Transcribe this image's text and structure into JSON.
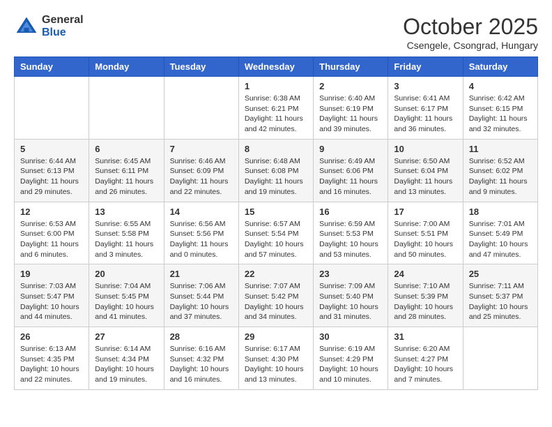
{
  "header": {
    "logo_general": "General",
    "logo_blue": "Blue",
    "month_title": "October 2025",
    "location": "Csengele, Csongrad, Hungary"
  },
  "days_of_week": [
    "Sunday",
    "Monday",
    "Tuesday",
    "Wednesday",
    "Thursday",
    "Friday",
    "Saturday"
  ],
  "weeks": [
    [
      null,
      null,
      null,
      {
        "day": "1",
        "sunrise": "Sunrise: 6:38 AM",
        "sunset": "Sunset: 6:21 PM",
        "daylight": "Daylight: 11 hours and 42 minutes."
      },
      {
        "day": "2",
        "sunrise": "Sunrise: 6:40 AM",
        "sunset": "Sunset: 6:19 PM",
        "daylight": "Daylight: 11 hours and 39 minutes."
      },
      {
        "day": "3",
        "sunrise": "Sunrise: 6:41 AM",
        "sunset": "Sunset: 6:17 PM",
        "daylight": "Daylight: 11 hours and 36 minutes."
      },
      {
        "day": "4",
        "sunrise": "Sunrise: 6:42 AM",
        "sunset": "Sunset: 6:15 PM",
        "daylight": "Daylight: 11 hours and 32 minutes."
      }
    ],
    [
      {
        "day": "5",
        "sunrise": "Sunrise: 6:44 AM",
        "sunset": "Sunset: 6:13 PM",
        "daylight": "Daylight: 11 hours and 29 minutes."
      },
      {
        "day": "6",
        "sunrise": "Sunrise: 6:45 AM",
        "sunset": "Sunset: 6:11 PM",
        "daylight": "Daylight: 11 hours and 26 minutes."
      },
      {
        "day": "7",
        "sunrise": "Sunrise: 6:46 AM",
        "sunset": "Sunset: 6:09 PM",
        "daylight": "Daylight: 11 hours and 22 minutes."
      },
      {
        "day": "8",
        "sunrise": "Sunrise: 6:48 AM",
        "sunset": "Sunset: 6:08 PM",
        "daylight": "Daylight: 11 hours and 19 minutes."
      },
      {
        "day": "9",
        "sunrise": "Sunrise: 6:49 AM",
        "sunset": "Sunset: 6:06 PM",
        "daylight": "Daylight: 11 hours and 16 minutes."
      },
      {
        "day": "10",
        "sunrise": "Sunrise: 6:50 AM",
        "sunset": "Sunset: 6:04 PM",
        "daylight": "Daylight: 11 hours and 13 minutes."
      },
      {
        "day": "11",
        "sunrise": "Sunrise: 6:52 AM",
        "sunset": "Sunset: 6:02 PM",
        "daylight": "Daylight: 11 hours and 9 minutes."
      }
    ],
    [
      {
        "day": "12",
        "sunrise": "Sunrise: 6:53 AM",
        "sunset": "Sunset: 6:00 PM",
        "daylight": "Daylight: 11 hours and 6 minutes."
      },
      {
        "day": "13",
        "sunrise": "Sunrise: 6:55 AM",
        "sunset": "Sunset: 5:58 PM",
        "daylight": "Daylight: 11 hours and 3 minutes."
      },
      {
        "day": "14",
        "sunrise": "Sunrise: 6:56 AM",
        "sunset": "Sunset: 5:56 PM",
        "daylight": "Daylight: 11 hours and 0 minutes."
      },
      {
        "day": "15",
        "sunrise": "Sunrise: 6:57 AM",
        "sunset": "Sunset: 5:54 PM",
        "daylight": "Daylight: 10 hours and 57 minutes."
      },
      {
        "day": "16",
        "sunrise": "Sunrise: 6:59 AM",
        "sunset": "Sunset: 5:53 PM",
        "daylight": "Daylight: 10 hours and 53 minutes."
      },
      {
        "day": "17",
        "sunrise": "Sunrise: 7:00 AM",
        "sunset": "Sunset: 5:51 PM",
        "daylight": "Daylight: 10 hours and 50 minutes."
      },
      {
        "day": "18",
        "sunrise": "Sunrise: 7:01 AM",
        "sunset": "Sunset: 5:49 PM",
        "daylight": "Daylight: 10 hours and 47 minutes."
      }
    ],
    [
      {
        "day": "19",
        "sunrise": "Sunrise: 7:03 AM",
        "sunset": "Sunset: 5:47 PM",
        "daylight": "Daylight: 10 hours and 44 minutes."
      },
      {
        "day": "20",
        "sunrise": "Sunrise: 7:04 AM",
        "sunset": "Sunset: 5:45 PM",
        "daylight": "Daylight: 10 hours and 41 minutes."
      },
      {
        "day": "21",
        "sunrise": "Sunrise: 7:06 AM",
        "sunset": "Sunset: 5:44 PM",
        "daylight": "Daylight: 10 hours and 37 minutes."
      },
      {
        "day": "22",
        "sunrise": "Sunrise: 7:07 AM",
        "sunset": "Sunset: 5:42 PM",
        "daylight": "Daylight: 10 hours and 34 minutes."
      },
      {
        "day": "23",
        "sunrise": "Sunrise: 7:09 AM",
        "sunset": "Sunset: 5:40 PM",
        "daylight": "Daylight: 10 hours and 31 minutes."
      },
      {
        "day": "24",
        "sunrise": "Sunrise: 7:10 AM",
        "sunset": "Sunset: 5:39 PM",
        "daylight": "Daylight: 10 hours and 28 minutes."
      },
      {
        "day": "25",
        "sunrise": "Sunrise: 7:11 AM",
        "sunset": "Sunset: 5:37 PM",
        "daylight": "Daylight: 10 hours and 25 minutes."
      }
    ],
    [
      {
        "day": "26",
        "sunrise": "Sunrise: 6:13 AM",
        "sunset": "Sunset: 4:35 PM",
        "daylight": "Daylight: 10 hours and 22 minutes."
      },
      {
        "day": "27",
        "sunrise": "Sunrise: 6:14 AM",
        "sunset": "Sunset: 4:34 PM",
        "daylight": "Daylight: 10 hours and 19 minutes."
      },
      {
        "day": "28",
        "sunrise": "Sunrise: 6:16 AM",
        "sunset": "Sunset: 4:32 PM",
        "daylight": "Daylight: 10 hours and 16 minutes."
      },
      {
        "day": "29",
        "sunrise": "Sunrise: 6:17 AM",
        "sunset": "Sunset: 4:30 PM",
        "daylight": "Daylight: 10 hours and 13 minutes."
      },
      {
        "day": "30",
        "sunrise": "Sunrise: 6:19 AM",
        "sunset": "Sunset: 4:29 PM",
        "daylight": "Daylight: 10 hours and 10 minutes."
      },
      {
        "day": "31",
        "sunrise": "Sunrise: 6:20 AM",
        "sunset": "Sunset: 4:27 PM",
        "daylight": "Daylight: 10 hours and 7 minutes."
      },
      null
    ]
  ]
}
